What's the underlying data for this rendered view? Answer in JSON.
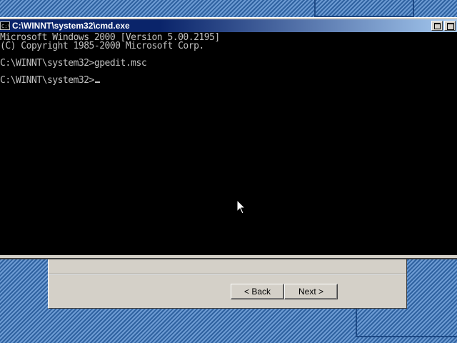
{
  "console": {
    "title": "C:\\WINNT\\system32\\cmd.exe",
    "icon_label": "C:\\",
    "lines": [
      "Microsoft Windows 2000 [Version 5.00.2195]",
      "(C) Copyright 1985-2000 Microsoft Corp.",
      "",
      "C:\\WINNT\\system32>gpedit.msc",
      "",
      "C:\\WINNT\\system32>"
    ],
    "text_color": "#c0c0c0",
    "background_color": "#000000"
  },
  "wizard": {
    "back_label": "< Back",
    "next_label": "Next >"
  },
  "colors": {
    "title_bar_start": "#0a246a",
    "title_bar_end": "#a6caf0",
    "desktop": "#3a6ea5",
    "dialog_face": "#d4d0c8"
  },
  "icons": {
    "console": "cmd-icon",
    "restore": "restore-icon",
    "maximize": "maximize-icon",
    "pointer": "mouse-pointer-icon"
  }
}
